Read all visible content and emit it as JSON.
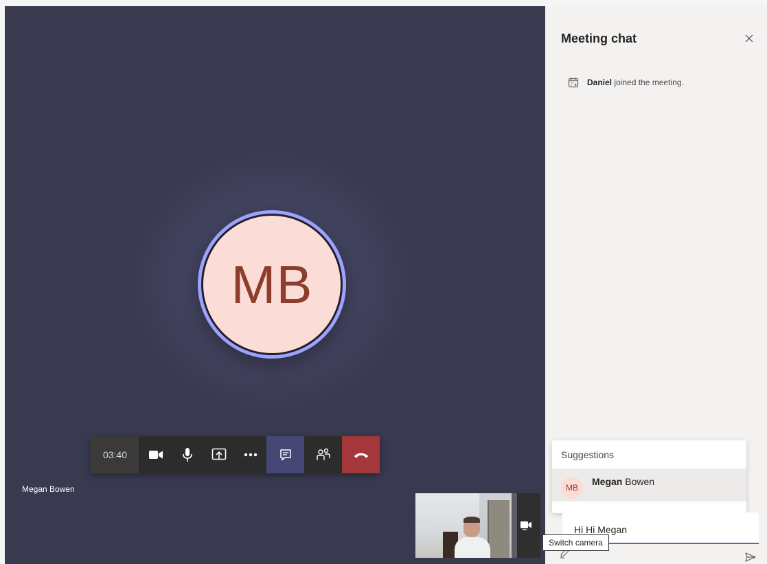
{
  "meeting": {
    "participant_initials": "MB",
    "participant_name": "Megan Bowen",
    "timer": "03:40"
  },
  "toolbar": {
    "buttons": [
      "camera-icon",
      "microphone-icon",
      "share-screen-icon",
      "more-options-icon",
      "chat-icon",
      "participants-icon",
      "hang-up-icon"
    ],
    "hangup_color": "#a4373a",
    "active_color": "#464775"
  },
  "self_view": {
    "tooltip": "Switch camera"
  },
  "chat": {
    "title": "Meeting chat",
    "event": {
      "name": "Daniel",
      "text": "joined the meeting."
    },
    "suggestions": {
      "title": "Suggestions",
      "item": {
        "initials": "MB",
        "first": "Megan",
        "last": "Bowen"
      }
    },
    "compose_value": "Hi Hi Megan"
  },
  "colors": {
    "accent": "#6264a7",
    "stage_bg": "#393a50",
    "avatar_ring": "#9ea2ff",
    "avatar_fill": "#fbdcd7",
    "avatar_text": "#8c3d2e"
  }
}
